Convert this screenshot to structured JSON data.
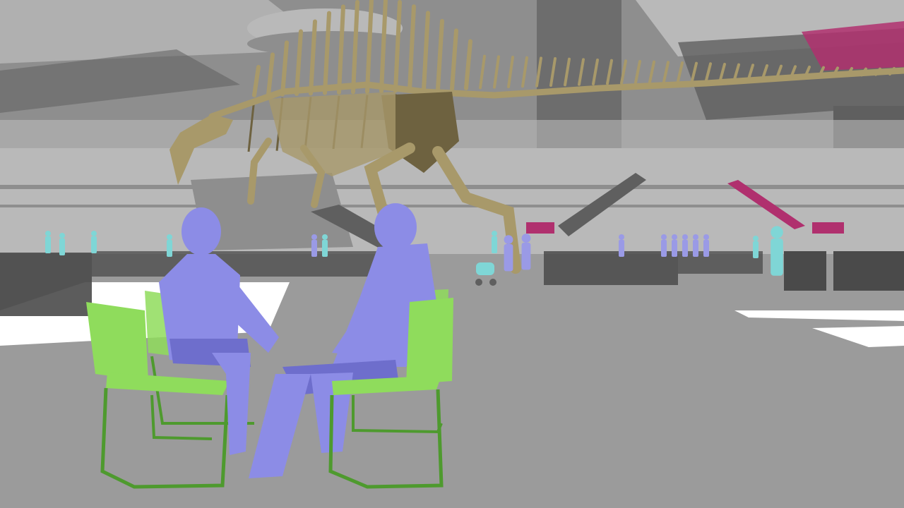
{
  "scene": {
    "subject": "museum-atrium-3d-render",
    "palette": {
      "sky": "#ffffff",
      "upper_structure": "#8e8e8e",
      "upper_structure_light": "#b9b9b9",
      "upper_structure_dark": "#5f5f5f",
      "floor": "#9b9b9b",
      "floor_highlight": "#ffffff",
      "counter": "#4a4a4a",
      "skeleton": "#a8996a",
      "skeleton_dark": "#6e6240",
      "accent_magenta": "#b0306e",
      "figure_seated": "#8c8ce6",
      "figure_seated_dark": "#6e6ecc",
      "figure_distant_cyan": "#7fd6d6",
      "figure_distant_violet": "#9a9ae6",
      "chair_green": "#8fdc5c",
      "chair_green_dark": "#4e9a2e"
    },
    "icons": [
      "dinosaur-skeleton",
      "seated-figure",
      "standing-figure",
      "chair",
      "stroller",
      "escalator"
    ]
  }
}
